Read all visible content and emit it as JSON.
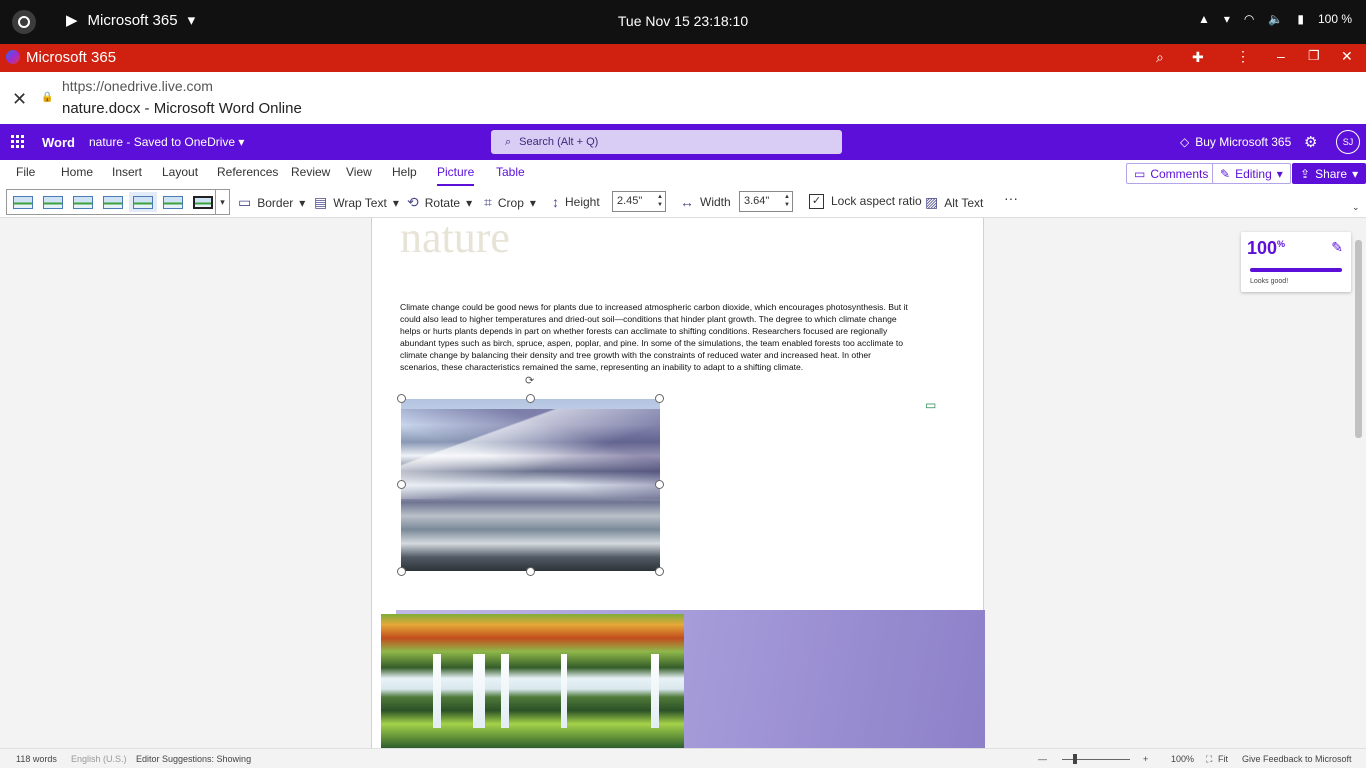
{
  "system": {
    "app_name": "Microsoft 365",
    "clock": "Tue Nov 15  23:18:10",
    "battery": "100 %"
  },
  "window": {
    "title": "Microsoft 365",
    "url": "https://onedrive.live.com",
    "doc_title": "nature.docx - Microsoft Word Online"
  },
  "word": {
    "app": "Word",
    "doc_name": "nature",
    "save_status": "Saved to OneDrive",
    "search_placeholder": "Search (Alt + Q)",
    "buy": "Buy Microsoft 365",
    "avatar": "SJ"
  },
  "tabs": [
    "File",
    "Home",
    "Insert",
    "Layout",
    "References",
    "Review",
    "View",
    "Help",
    "Picture",
    "Table"
  ],
  "active_tab": "Picture",
  "ribbon_buttons": {
    "comments": "Comments",
    "editing": "Editing",
    "share": "Share"
  },
  "toolbar": {
    "border": "Border",
    "wrap_text": "Wrap Text",
    "rotate": "Rotate",
    "crop": "Crop",
    "height_label": "Height",
    "height_value": "2.45\"",
    "width_label": "Width",
    "width_value": "3.64\"",
    "lock_aspect": "Lock aspect ratio",
    "lock_aspect_checked": true,
    "alt_text": "Alt Text"
  },
  "document": {
    "heading": "nature",
    "paragraph": "Climate change could be good news for plants due to increased atmospheric carbon dioxide, which encourages photosynthesis. But it could also lead to higher temperatures and dried-out soil—conditions that hinder plant growth. The degree to which climate change helps or hurts plants depends in part on whether forests can acclimate to shifting conditions. Researchers focused are regionally abundant types such as birch, spruce, aspen, poplar, and pine. In some of the simulations, the team enabled forests too acclimate to climate change by balancing their density and tree growth with the constraints of reduced water and increased heat. In other scenarios, these characteristics remained the same, representing an inability to adapt to a shifting climate."
  },
  "editor_score": {
    "value": "100",
    "unit": "%",
    "message": "Looks good!"
  },
  "status": {
    "words": "118 words",
    "language": "English (U.S.)",
    "suggestions": "Editor Suggestions: Showing",
    "zoom": "100%",
    "fit": "Fit",
    "feedback": "Give Feedback to Microsoft"
  }
}
